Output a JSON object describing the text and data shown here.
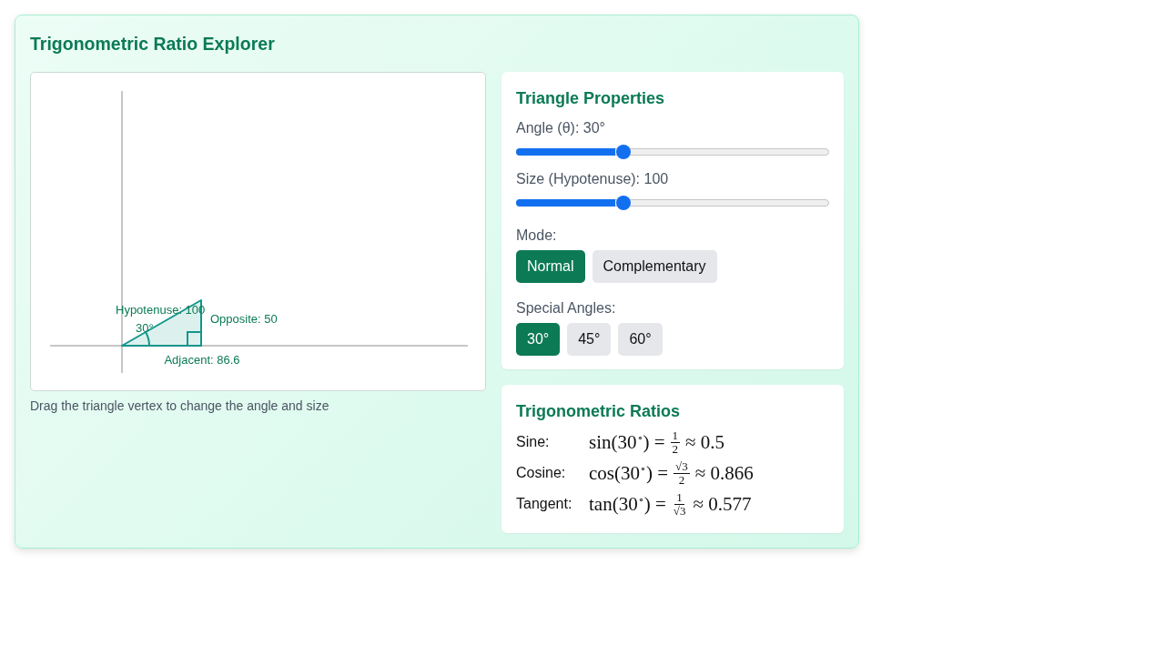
{
  "title": "Trigonometric Ratio Explorer",
  "diagram": {
    "hypotenuse_label": "Hypotenuse: 100",
    "angle_label": "30°",
    "opposite_label": "Opposite: 50",
    "adjacent_label": "Adjacent: 86.6"
  },
  "caption": "Drag the triangle vertex to change the angle and size",
  "properties": {
    "title": "Triangle Properties",
    "sliders": [
      {
        "label": "Angle (θ): 30°",
        "level": 0.333
      },
      {
        "label": "Size (Hypotenuse): 100",
        "level": 0.333
      }
    ],
    "mode": {
      "label": "Mode:",
      "options": [
        {
          "label": "Normal",
          "selected": true
        },
        {
          "label": "Complementary",
          "selected": false
        }
      ]
    },
    "special_angles": {
      "label": "Special Angles:",
      "options": [
        {
          "label": "30°",
          "selected": true
        },
        {
          "label": "45°",
          "selected": false
        },
        {
          "label": "60°",
          "selected": false
        }
      ]
    }
  },
  "ratios": {
    "title": "Trigonometric Ratios",
    "rows": [
      {
        "label": "Sine:",
        "lhs": "sin(30$^{∘}$) =",
        "numerator": "1",
        "denominator": "2",
        "approx": "≈ 0.5"
      },
      {
        "label": "Cosine:",
        "lhs": "cos(30$^{∘}$) =",
        "numerator": "√3",
        "denominator": "2",
        "approx": "≈ 0.866"
      },
      {
        "label": "Tangent:",
        "lhs": "tan(30$^{∘}$) =",
        "numerator": "1",
        "denominator": "√3",
        "approx": "≈ 0.577"
      }
    ]
  }
}
